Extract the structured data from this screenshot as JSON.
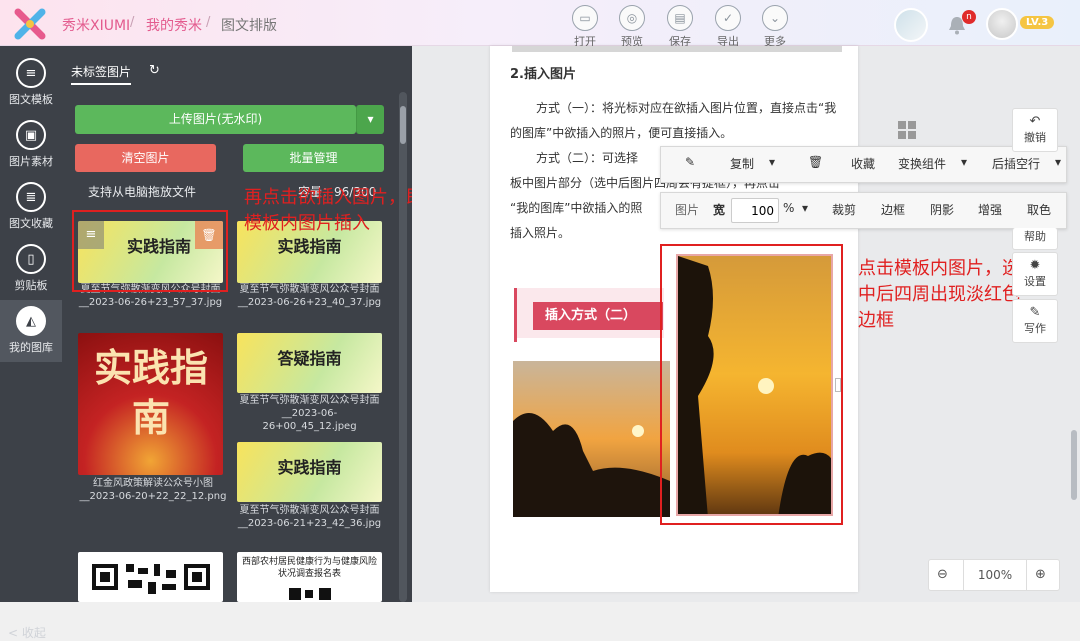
{
  "header": {
    "brand": "秀米XIUMI",
    "crumb1": "我的秀米",
    "crumb2": "图文排版",
    "tools": [
      {
        "label": "打开",
        "icon": "folder-icon"
      },
      {
        "label": "预览",
        "icon": "fingerprint-icon"
      },
      {
        "label": "保存",
        "icon": "save-icon"
      },
      {
        "label": "导出",
        "icon": "check-icon"
      },
      {
        "label": "更多",
        "icon": "chevron-down-icon"
      }
    ],
    "notification_count": "n",
    "level": "LV.3"
  },
  "left_nav": {
    "items": [
      {
        "label": "图文模板",
        "icon": "list-icon"
      },
      {
        "label": "图片素材",
        "icon": "image-icon"
      },
      {
        "label": "图文收藏",
        "icon": "favorite-icon"
      },
      {
        "label": "剪贴板",
        "icon": "clipboard-icon"
      },
      {
        "label": "我的图库",
        "icon": "gallery-icon"
      }
    ],
    "collapse": "< 收起"
  },
  "panel": {
    "tab": "未标签图片",
    "upload": "上传图片(无水印)",
    "clear": "清空图片",
    "batch": "批量管理",
    "drop_hint": "支持从电脑拖放文件",
    "capacity": "容量：96/300",
    "images": [
      {
        "title": "实践指南",
        "caption": "夏至节气弥散渐变风公众号封面__2023-06-26+23_57_37.jpg"
      },
      {
        "title": "实践指南",
        "caption": "夏至节气弥散渐变风公众号封面__2023-06-26+23_40_37.jpg"
      },
      {
        "title": "实践指南",
        "caption": "红金风政策解读公众号小图__2023-06-20+22_22_12.png"
      },
      {
        "title": "答疑指南",
        "caption": "夏至节气弥散渐变风公众号封面__2023-06-26+00_45_12.jpeg"
      },
      {
        "title": "实践指南",
        "caption": "夏至节气弥散渐变风公众号封面__2023-06-21+23_42_36.jpg"
      },
      {
        "title": "西部农村居民健康行为与健康风险状况调查报名表",
        "caption": ""
      }
    ]
  },
  "annotations": {
    "left": "再点击欲插入图片，即可实现模板内图片插入",
    "right": "点击模板内图片，选中后四周出现淡红色边框"
  },
  "document": {
    "heading": "2.插入图片",
    "para1": "方式（一）：将光标对应在欲插入图片位置，直接点击“我的图库”中欲插入的照片，便可直接插入。",
    "para2_lines": [
      "方式（二）：可选择",
      "板中图片部分（选中后图片四周会有提框），再点击",
      "“我的图库”中欲插入的照",
      "插入照片。"
    ],
    "banner": "插入方式（二）"
  },
  "toolbar1": {
    "items": [
      "复制",
      "收藏",
      "变换组件",
      "后插空行"
    ]
  },
  "toolbar2": {
    "label": "图片",
    "width_label": "宽",
    "width_value": "100",
    "unit": "%",
    "items": [
      "裁剪",
      "边框",
      "阴影",
      "增强",
      "取色"
    ]
  },
  "right_panel": {
    "buttons": [
      {
        "label": "撤销",
        "icon": "undo-icon"
      },
      {
        "label": "帮助",
        "icon": "help-icon"
      },
      {
        "label": "设置",
        "icon": "gear-icon"
      },
      {
        "label": "写作",
        "icon": "pen-icon"
      }
    ]
  },
  "zoom": {
    "value": "100%"
  },
  "colors": {
    "accent": "#e35b8e",
    "green": "#5cb85c",
    "red": "#e8685f",
    "nav": "#3d4148",
    "annotation": "#e02020"
  }
}
